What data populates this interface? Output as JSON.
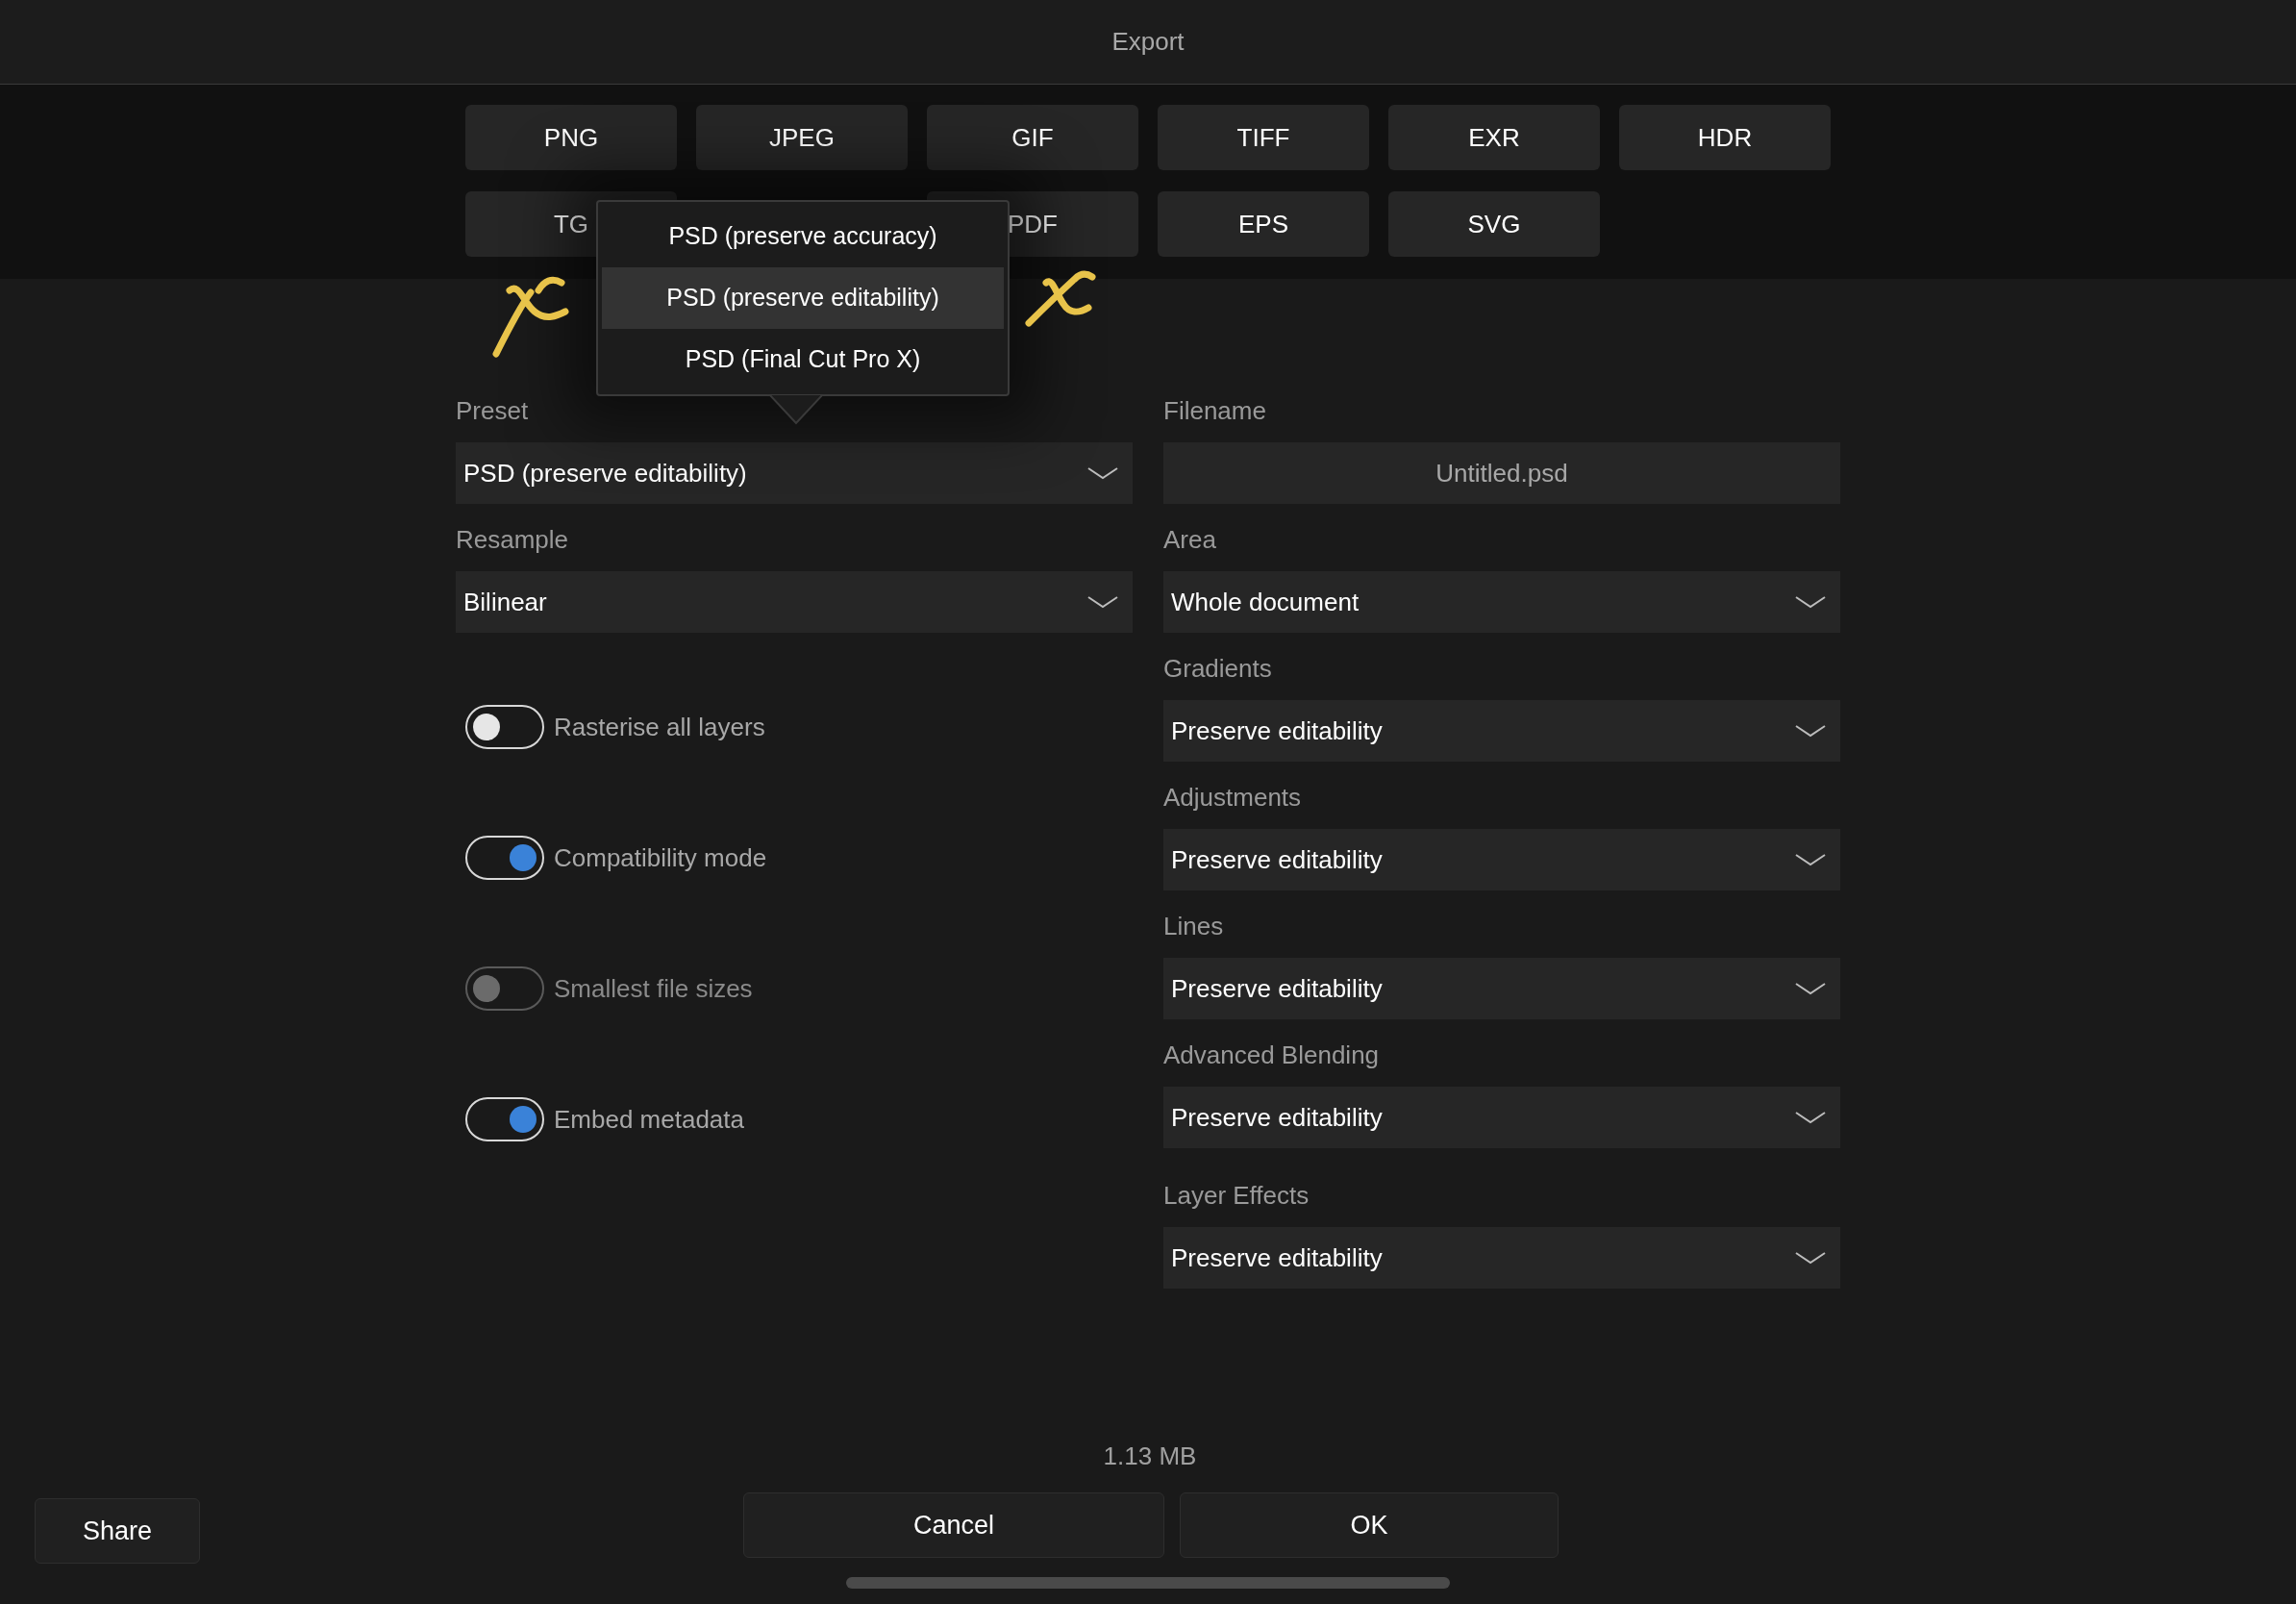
{
  "window": {
    "title": "Export"
  },
  "formats": {
    "row_1": [
      {
        "label": "PNG"
      },
      {
        "label": "JPEG"
      },
      {
        "label": "GIF"
      },
      {
        "label": "TIFF"
      },
      {
        "label": "EXR"
      },
      {
        "label": "HDR"
      }
    ],
    "row_2": [
      {
        "label": "TG"
      },
      {
        "label": "PDF"
      },
      {
        "label": "EPS"
      },
      {
        "label": "SVG"
      }
    ]
  },
  "preset_menu": [
    {
      "label": "PSD (preserve accuracy)",
      "selected": false
    },
    {
      "label": "PSD (preserve editability)",
      "selected": true
    },
    {
      "label": "PSD (Final Cut Pro X)",
      "selected": false
    }
  ],
  "left_fields": [
    {
      "label": "Preset",
      "value": "PSD (preserve editability)"
    },
    {
      "label": "Resample",
      "value": "Bilinear"
    }
  ],
  "toggles": [
    {
      "label": "Rasterise all layers",
      "on": false,
      "disabled": false
    },
    {
      "label": "Compatibility mode",
      "on": true,
      "disabled": false
    },
    {
      "label": "Smallest file sizes",
      "on": false,
      "disabled": true
    },
    {
      "label": "Embed metadata",
      "on": true,
      "disabled": false
    }
  ],
  "filename": {
    "label": "Filename",
    "value": "Untitled.psd"
  },
  "right_fields": [
    {
      "label": "Area",
      "value": "Whole document"
    },
    {
      "label": "Gradients",
      "value": "Preserve editability"
    },
    {
      "label": "Adjustments",
      "value": "Preserve editability"
    },
    {
      "label": "Lines",
      "value": "Preserve editability"
    },
    {
      "label": "Advanced Blending",
      "value": "Preserve editability"
    },
    {
      "label": "Layer Effects",
      "value": "Preserve editability"
    }
  ],
  "file_size": "1.13 MB",
  "buttons": {
    "cancel": "Cancel",
    "ok": "OK",
    "share": "Share"
  }
}
